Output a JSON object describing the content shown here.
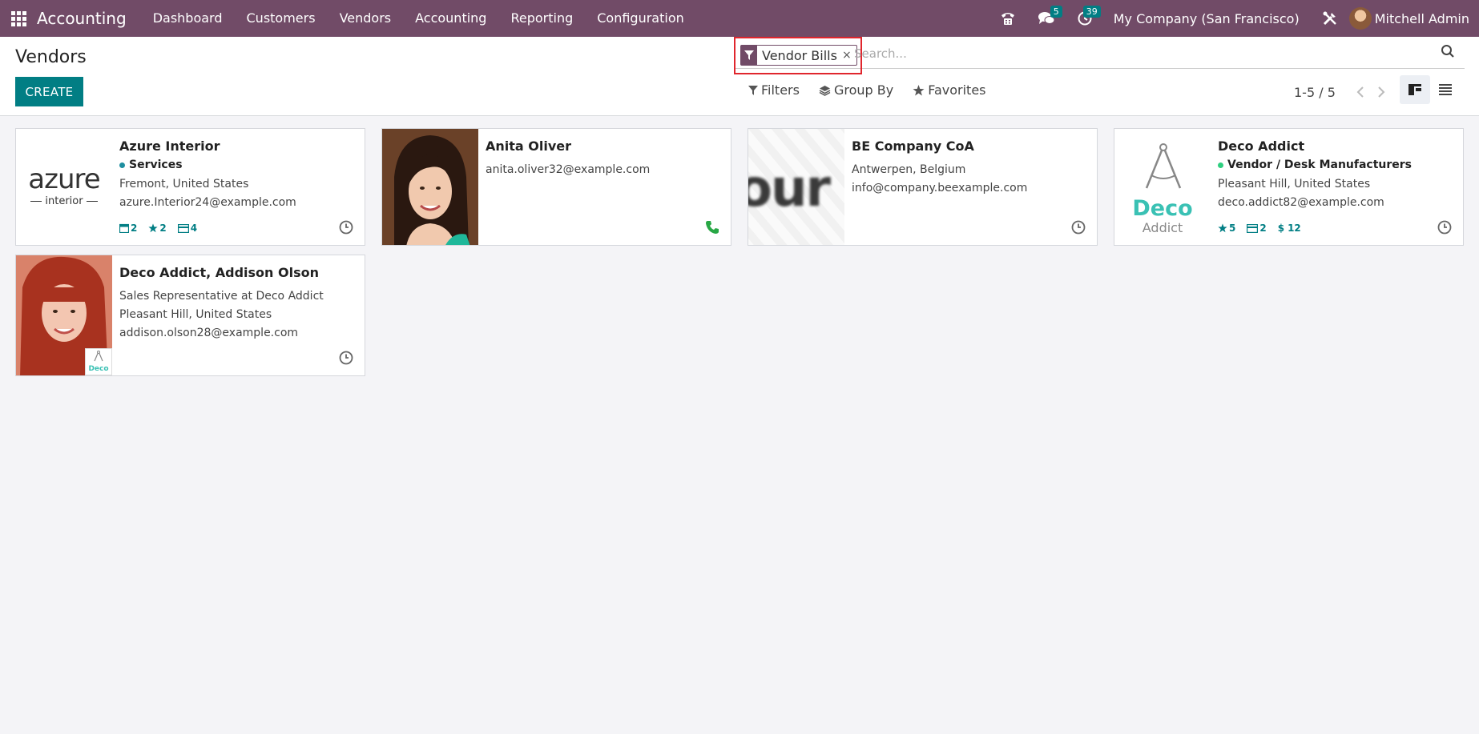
{
  "navbar": {
    "app_title": "Accounting",
    "menu": [
      "Dashboard",
      "Customers",
      "Vendors",
      "Accounting",
      "Reporting",
      "Configuration"
    ],
    "messages_count": "5",
    "activities_count": "39",
    "company": "My Company (San Francisco)",
    "user": "Mitchell Admin"
  },
  "control": {
    "title": "Vendors",
    "create_label": "CREATE",
    "facet_label": "Vendor Bills",
    "facet_remove": "×",
    "search_placeholder": "Search...",
    "filters_label": "Filters",
    "groupby_label": "Group By",
    "favorites_label": "Favorites",
    "pager": "1-5 / 5",
    "active_view": "kanban"
  },
  "cards": [
    {
      "name": "Azure Interior",
      "tag": "Services",
      "tag_color": "#1f8fa0",
      "lines": [
        "Fremont, United States",
        "azure.Interior24@example.com"
      ],
      "stats": [
        "2",
        "2",
        "4"
      ],
      "logo_top": "azure",
      "logo_bottom": "interior",
      "action": "clock-icon"
    },
    {
      "name": "Anita Oliver",
      "lines": [
        "anita.oliver32@example.com"
      ],
      "action": "phone-icon"
    },
    {
      "name": "BE Company CoA",
      "lines": [
        "Antwerpen, Belgium",
        "info@company.beexample.com"
      ],
      "logo_text": "our",
      "action": "clock-icon"
    },
    {
      "name": "Deco Addict",
      "tag": "Vendor / Desk Manufacturers",
      "tag_color": "#2ecf7f",
      "lines": [
        "Pleasant Hill, United States",
        "deco.addict82@example.com"
      ],
      "stats": [
        "5",
        "2",
        "12"
      ],
      "logo_top": "Deco",
      "logo_bottom": "Addict",
      "action": "clock-icon"
    },
    {
      "name": "Deco Addict, Addison Olson",
      "lines": [
        "Sales Representative at Deco Addict",
        "Pleasant Hill, United States",
        "addison.olson28@example.com"
      ],
      "badge_text": "Deco",
      "action": "clock-icon"
    }
  ]
}
